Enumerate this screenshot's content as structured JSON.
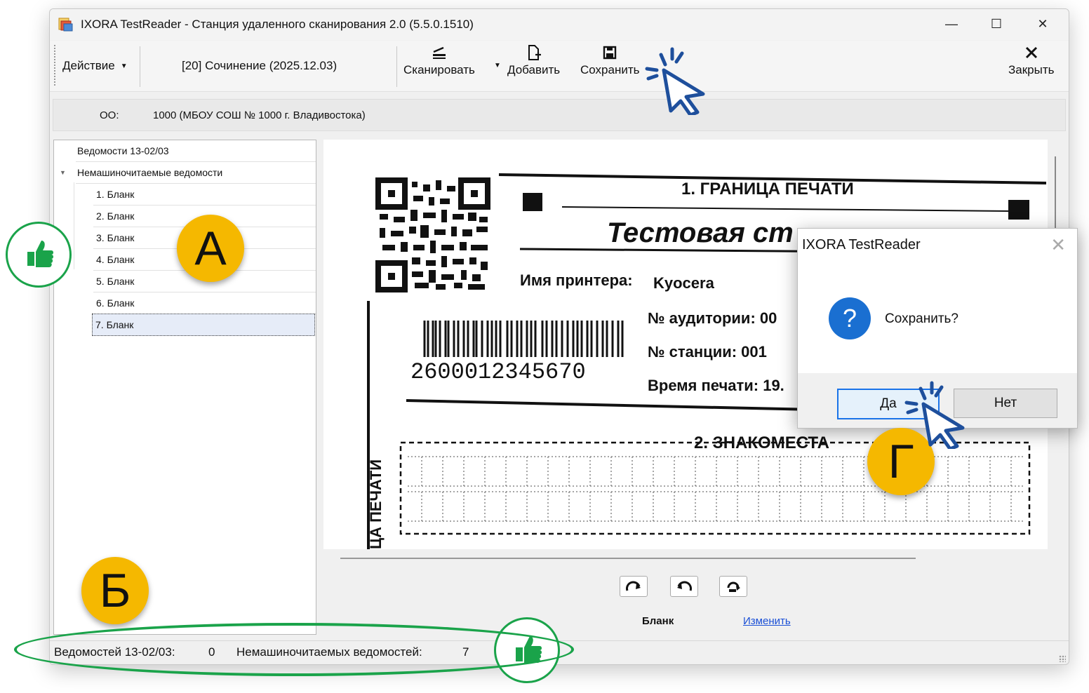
{
  "window": {
    "title": "IXORA TestReader - Станция удаленного сканирования 2.0 (5.5.0.1510)",
    "minimize": "—",
    "maximize": "☐",
    "close": "✕"
  },
  "toolbar": {
    "action_label": "Действие",
    "test_label": "[20] Сочинение (2025.12.03)",
    "scan_label": "Сканировать",
    "add_label": "Добавить",
    "save_label": "Сохранить",
    "close_label": "Закрыть"
  },
  "org": {
    "label": "ОО:",
    "value": "1000 (МБОУ СОШ № 1000 г. Владивостока)"
  },
  "tree": {
    "root1": "Ведомости 13-02/03",
    "root2": "Немашиночитаемые ведомости",
    "items": [
      "1. Бланк",
      "2. Бланк",
      "3. Бланк",
      "4. Бланк",
      "5. Бланк",
      "6. Бланк",
      "7. Бланк"
    ],
    "selected_index": 6
  },
  "scan": {
    "section1": "1. ГРАНИЦА ПЕЧАТИ",
    "heading": "Тестовая ст",
    "printer_label": "Имя принтера:",
    "printer_value": "Kyocera",
    "room": "№ аудитории: 00",
    "station": "№ станции: 001",
    "print_time": "Время печати: 19.",
    "barcode_number": "2600012345670",
    "section2": "2. ЗНАКОМЕСТА",
    "side_text": "ЦА ПЕЧАТИ"
  },
  "viewer": {
    "blank_label": "Бланк",
    "change_link": "Изменить"
  },
  "status": {
    "vedomosti_label": "Ведомостей 13-02/03:",
    "vedomosti_count": "0",
    "nonmachine_label": "Немашиночитаемых ведомостей:",
    "nonmachine_count": "7"
  },
  "dialog": {
    "title": "IXORA TestReader",
    "close": "✕",
    "icon": "?",
    "message": "Сохранить?",
    "yes": "Да",
    "no": "Нет"
  },
  "annotations": {
    "badge_a": "А",
    "badge_b": "Б",
    "badge_g": "Г"
  },
  "colors": {
    "badge": "#f5b800",
    "highlight_green": "#1aa34a",
    "cursor_blue": "#1e4f9c",
    "link": "#1a4fd6"
  }
}
